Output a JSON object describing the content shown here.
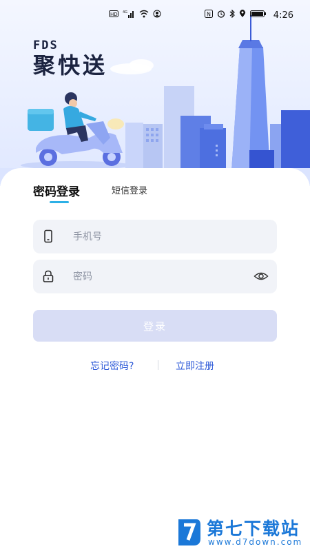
{
  "status_bar": {
    "left_icons": [
      "hd-icon",
      "4g-signal-icon",
      "wifi-icon",
      "hotspot-icon"
    ],
    "right_icons": [
      "nfc-icon",
      "alarm-icon",
      "bluetooth-icon",
      "location-icon",
      "battery-icon"
    ],
    "time": "4:26"
  },
  "brand": {
    "logo_en": "FDS",
    "logo_cn": "聚快送"
  },
  "tabs": {
    "password_login": "密码登录",
    "sms_login": "短信登录"
  },
  "form": {
    "phone_placeholder": "手机号",
    "password_placeholder": "密码",
    "phone_value": "",
    "password_value": ""
  },
  "login_button": "登录",
  "links": {
    "forgot_password": "忘记密码?",
    "register": "立即注册"
  },
  "watermark": {
    "title": "第七下载站",
    "url": "www.d7down.com"
  },
  "colors": {
    "accent_tab": "#2db0e6",
    "link": "#2f5bd8",
    "button_disabled": "#d8ddf5",
    "field_bg": "#f1f3f8"
  }
}
